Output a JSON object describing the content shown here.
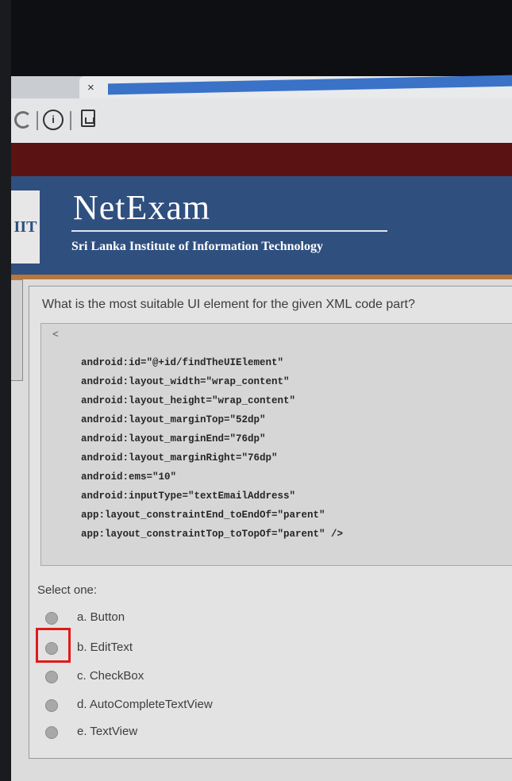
{
  "browser": {
    "tab_close": "×",
    "info_icon": "i"
  },
  "header": {
    "logo_text": "IIT",
    "brand": "NetExam",
    "subtitle": "Sri Lanka Institute of Information Technology"
  },
  "question": {
    "text": "What is the most suitable UI element for the given XML code part?",
    "code_open": "<",
    "code_lines": [
      "android:id=\"@+id/findTheUIElement\"",
      "android:layout_width=\"wrap_content\"",
      "android:layout_height=\"wrap_content\"",
      "android:layout_marginTop=\"52dp\"",
      "android:layout_marginEnd=\"76dp\"",
      "android:layout_marginRight=\"76dp\"",
      "android:ems=\"10\"",
      "android:inputType=\"textEmailAddress\"",
      "app:layout_constraintEnd_toEndOf=\"parent\"",
      "app:layout_constraintTop_toTopOf=\"parent\" />"
    ],
    "select_label": "Select one:",
    "options": [
      {
        "label": "a. Button",
        "highlighted": false
      },
      {
        "label": "b. EditText",
        "highlighted": true
      },
      {
        "label": "c. CheckBox",
        "highlighted": false
      },
      {
        "label": "d. AutoCompleteTextView",
        "highlighted": false
      },
      {
        "label": "e. TextView",
        "highlighted": false
      }
    ]
  },
  "colors": {
    "header_bg": "#2f4f7f",
    "top_band": "#5b1212",
    "highlight": "#e01a1a"
  }
}
